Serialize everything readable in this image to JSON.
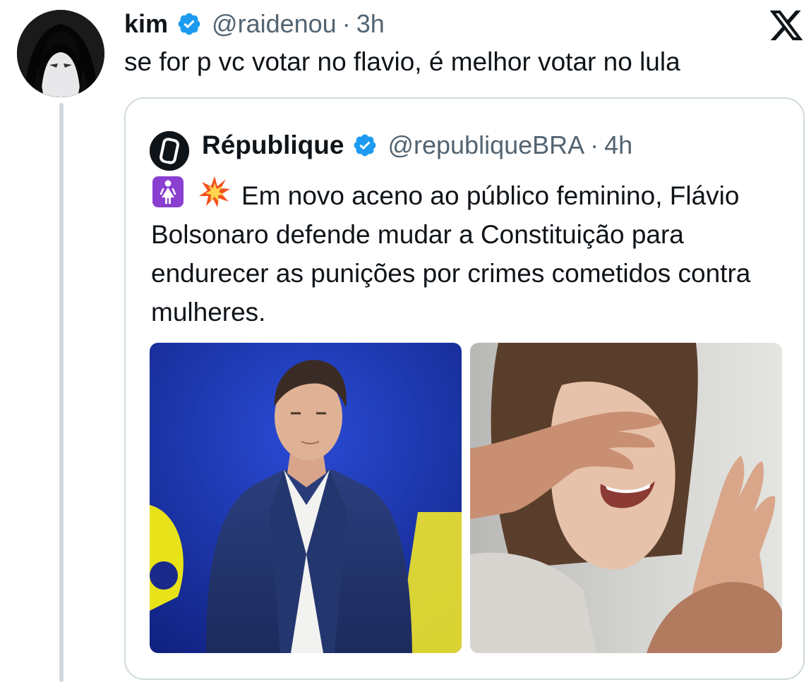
{
  "tweet": {
    "author_name": "kim",
    "handle": "@raidenou",
    "separator": "·",
    "time": "3h",
    "text": "se for p vc votar no flavio, é melhor votar no lula",
    "verified_icon": "verified-badge-icon",
    "avatar_icon": "anime-avatar"
  },
  "platform": {
    "logo_icon": "x-logo-icon"
  },
  "quoted": {
    "author_name": "République",
    "handle": "@republiqueBRA",
    "separator": "·",
    "time": "4h",
    "emoji_1": "woman-sign-emoji",
    "emoji_2": "collision-emoji",
    "text": "Em novo aceno ao público feminino, Flávio Bolsonaro defende mudar a Constituição para endurecer as punições por crimes cometidos contra mulheres.",
    "media": [
      {
        "kind": "photo",
        "subject": "man-in-suit-on-stage"
      },
      {
        "kind": "photo",
        "subject": "woman-being-covered-by-hand"
      }
    ]
  },
  "colors": {
    "verified_blue": "#1d9bf0",
    "text_primary": "#0f1419",
    "text_secondary": "#536471",
    "border": "#cfd9de"
  }
}
